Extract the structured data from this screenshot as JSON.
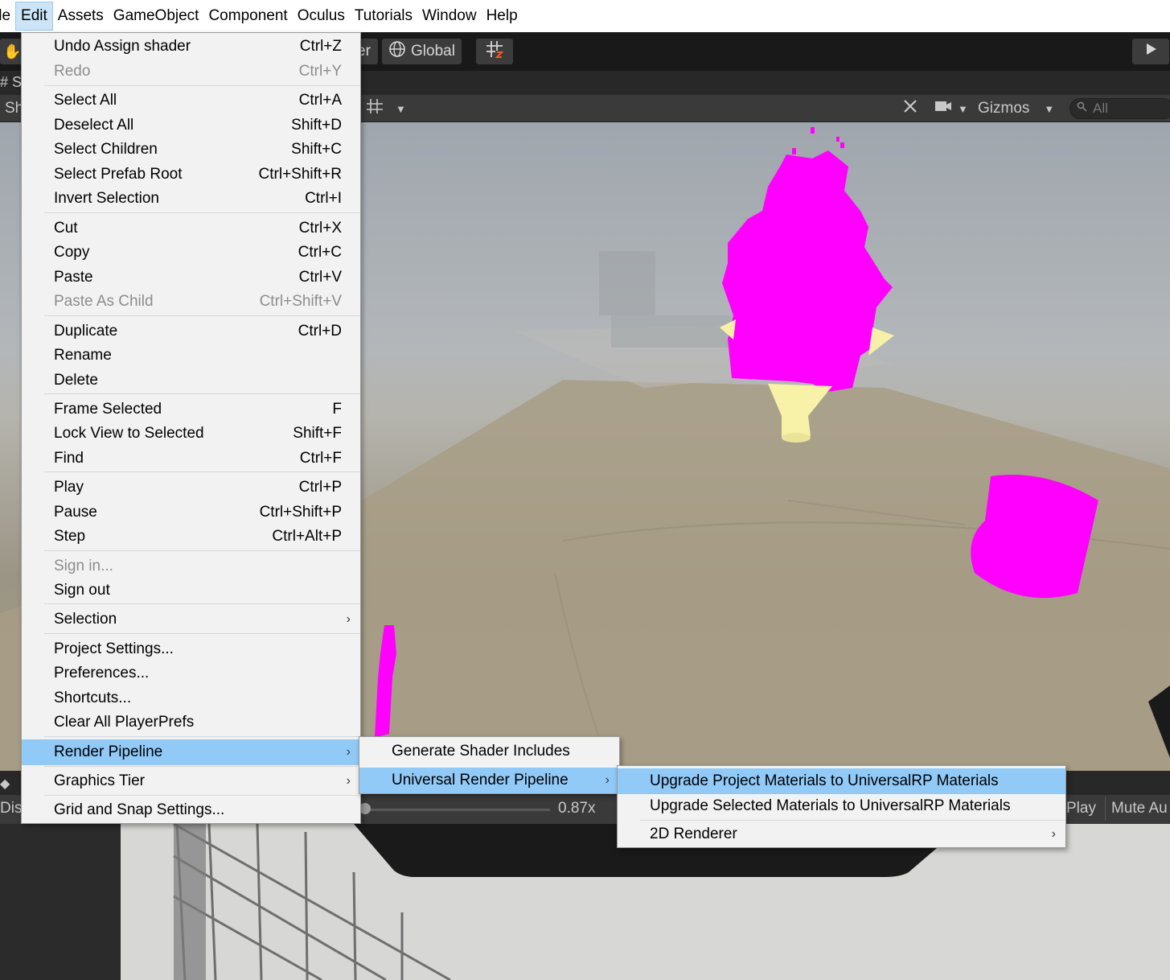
{
  "menubar": {
    "items": [
      "ile",
      "Edit",
      "Assets",
      "GameObject",
      "Component",
      "Oculus",
      "Tutorials",
      "Window",
      "Help"
    ]
  },
  "toolbar": {
    "pivot_partial": "er",
    "global_label": "Global"
  },
  "left_strip": {
    "tab_partial": "#  S",
    "shaded_partial": "Sha",
    "display_partial": "Disp"
  },
  "scene_toolbar": {
    "gizmos_label": "Gizmos",
    "search_placeholder": "All"
  },
  "game_toolbar": {
    "scale_value": "0.87x",
    "play_label": "Play",
    "mute_label": "Mute Au"
  },
  "edit_menu": {
    "items": [
      {
        "label": "Undo Assign shader",
        "shortcut": "Ctrl+Z"
      },
      {
        "label": "Redo",
        "shortcut": "Ctrl+Y",
        "disabled": true
      },
      {
        "label": "Select All",
        "shortcut": "Ctrl+A"
      },
      {
        "label": "Deselect All",
        "shortcut": "Shift+D"
      },
      {
        "label": "Select Children",
        "shortcut": "Shift+C"
      },
      {
        "label": "Select Prefab Root",
        "shortcut": "Ctrl+Shift+R"
      },
      {
        "label": "Invert Selection",
        "shortcut": "Ctrl+I"
      },
      {
        "label": "Cut",
        "shortcut": "Ctrl+X"
      },
      {
        "label": "Copy",
        "shortcut": "Ctrl+C"
      },
      {
        "label": "Paste",
        "shortcut": "Ctrl+V"
      },
      {
        "label": "Paste As Child",
        "shortcut": "Ctrl+Shift+V",
        "disabled": true
      },
      {
        "label": "Duplicate",
        "shortcut": "Ctrl+D"
      },
      {
        "label": "Rename",
        "shortcut": ""
      },
      {
        "label": "Delete",
        "shortcut": ""
      },
      {
        "label": "Frame Selected",
        "shortcut": "F"
      },
      {
        "label": "Lock View to Selected",
        "shortcut": "Shift+F"
      },
      {
        "label": "Find",
        "shortcut": "Ctrl+F"
      },
      {
        "label": "Play",
        "shortcut": "Ctrl+P"
      },
      {
        "label": "Pause",
        "shortcut": "Ctrl+Shift+P"
      },
      {
        "label": "Step",
        "shortcut": "Ctrl+Alt+P"
      },
      {
        "label": "Sign in...",
        "shortcut": "",
        "disabled": true
      },
      {
        "label": "Sign out",
        "shortcut": ""
      },
      {
        "label": "Selection",
        "shortcut": "",
        "submenu": true
      },
      {
        "label": "Project Settings...",
        "shortcut": ""
      },
      {
        "label": "Preferences...",
        "shortcut": ""
      },
      {
        "label": "Shortcuts...",
        "shortcut": ""
      },
      {
        "label": "Clear All PlayerPrefs",
        "shortcut": ""
      },
      {
        "label": "Render Pipeline",
        "shortcut": "",
        "submenu": true,
        "highlighted": true
      },
      {
        "label": "Graphics Tier",
        "shortcut": "",
        "submenu": true
      },
      {
        "label": "Grid and Snap Settings...",
        "shortcut": ""
      }
    ]
  },
  "render_pipeline_menu": {
    "items": [
      {
        "label": "Generate Shader Includes",
        "submenu": false
      },
      {
        "label": "Universal Render Pipeline",
        "submenu": true,
        "highlighted": true
      }
    ]
  },
  "urp_menu": {
    "items": [
      {
        "label": "Upgrade Project Materials to UniversalRP Materials",
        "submenu": false,
        "highlighted": true
      },
      {
        "label": "Upgrade Selected Materials to UniversalRP Materials",
        "submenu": false
      },
      {
        "label": "2D Renderer",
        "submenu": true
      }
    ]
  },
  "colors": {
    "highlight": "#91c9f7",
    "menubar_active": "#cce4f7",
    "missing_shader_magenta": "#ff00ff",
    "editor_dark": "#191919"
  }
}
